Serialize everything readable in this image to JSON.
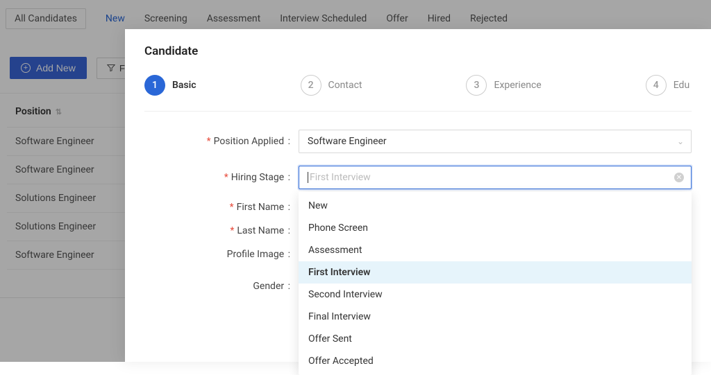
{
  "tabs": [
    "All Candidates",
    "New",
    "Screening",
    "Assessment",
    "Interview Scheduled",
    "Offer",
    "Hired",
    "Rejected"
  ],
  "toolbar": {
    "add_new_label": "Add New",
    "filter_label": "Filter"
  },
  "table": {
    "header_position": "Position",
    "rows": [
      "Software Engineer",
      "Software Engineer",
      "Solutions Engineer",
      "Solutions Engineer",
      "Software Engineer"
    ]
  },
  "drawer": {
    "title": "Candidate",
    "steps": [
      {
        "num": "1",
        "label": "Basic"
      },
      {
        "num": "2",
        "label": "Contact"
      },
      {
        "num": "3",
        "label": "Experience"
      },
      {
        "num": "4",
        "label": "Edu"
      }
    ],
    "form": {
      "position_applied": {
        "label": "Position Applied",
        "value": "Software Engineer"
      },
      "hiring_stage": {
        "label": "Hiring Stage",
        "placeholder": "First Interview",
        "options": [
          "New",
          "Phone Screen",
          "Assessment",
          "First Interview",
          "Second Interview",
          "Final Interview",
          "Offer Sent",
          "Offer Accepted"
        ],
        "highlighted": "First Interview"
      },
      "first_name": {
        "label": "First Name"
      },
      "last_name": {
        "label": "Last Name"
      },
      "profile_image": {
        "label": "Profile Image"
      },
      "gender": {
        "label": "Gender"
      }
    }
  }
}
